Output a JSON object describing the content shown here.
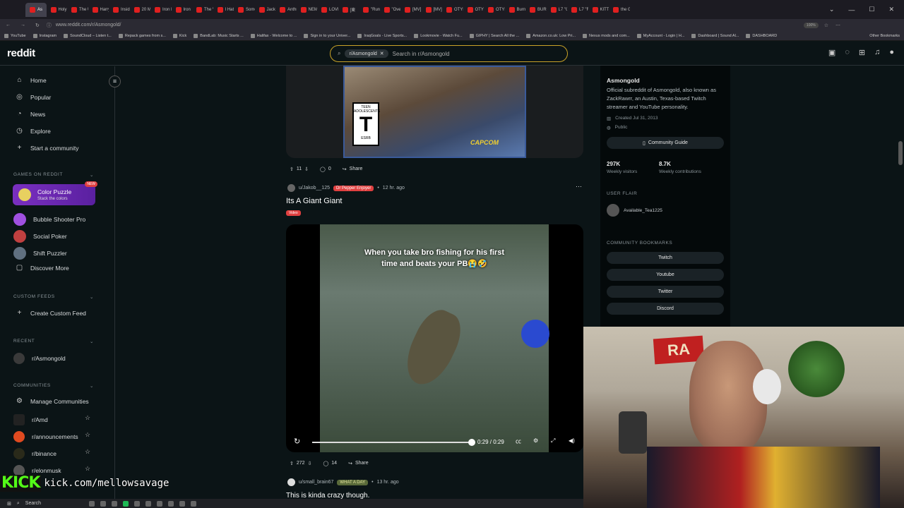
{
  "browser": {
    "tabs": [
      "As",
      "Holy",
      "The U",
      "Harry",
      "Insid",
      "20 Mi",
      "Iron M",
      "Iron M",
      "The V",
      "I Hatz",
      "Some",
      "Jack I",
      "Anthr",
      "NEMO",
      "LOVE",
      "[東",
      "\"Run",
      "\"Ove",
      "[MV]",
      "[MV]",
      "OTYK",
      "OTYK",
      "OTYK",
      "Burni",
      "BURN",
      "L7 \"C",
      "L7 \"R",
      "KITTE",
      "the G"
    ],
    "url": "www.reddit.com/r/Asmongold/",
    "zoom": "100%",
    "bookmarks": [
      "YouTube",
      "Instagram",
      "SoundCloud – Listen t...",
      "Repack games from s...",
      "Kick",
      "BandLab: Music Starts ...",
      "Halifax - Welcome to ...",
      "Sign in to your Univer...",
      "IraqGoals - Live Sports...",
      "Lookmovie - Watch Fu...",
      "GIPHY | Search All the ...",
      "Amazon.co.uk: Low Pri...",
      "Nexus mods and com...",
      "MyAccount - Login | H...",
      "Dashboard | Sound Al...",
      "DASHBOARD"
    ],
    "other_bookmarks": "Other Bookmarks"
  },
  "header": {
    "logo": "reddit",
    "search_chip": "r/Asmongold",
    "search_placeholder": "Search in r/Asmongold"
  },
  "sidebar": {
    "nav": [
      "Home",
      "Popular",
      "News",
      "Explore",
      "Start a community"
    ],
    "games_title": "GAMES ON REDDIT",
    "featured_game": {
      "name": "Color Puzzle",
      "sub": "Stack the colors",
      "badge": "NEW"
    },
    "games": [
      "Bubble Shooter Pro",
      "Social Poker",
      "Shift Puzzler",
      "Discover More"
    ],
    "custom_feeds_title": "CUSTOM FEEDS",
    "create_feed": "Create Custom Feed",
    "recent_title": "RECENT",
    "recent": [
      "r/Asmongold"
    ],
    "communities_title": "COMMUNITIES",
    "manage": "Manage Communities",
    "communities": [
      "r/Amd",
      "r/announcements",
      "r/binance",
      "r/elonmusk"
    ]
  },
  "feed": {
    "post1": {
      "upvotes": "11",
      "comments": "0",
      "share": "Share",
      "rating_top": "TEEN ADOLESCENTS",
      "rating_letter": "T",
      "rating_bottom": "ESRB",
      "publisher": "CAPCOM"
    },
    "post2": {
      "author": "u/Jakob__125",
      "flair": "Dr Pepper Enjoyer",
      "time": "12 hr. ago",
      "title": "Its A Giant Giant",
      "tag": "Video",
      "caption": "When you take bro fishing for his first time and beats your PB😭🤣",
      "time_display": "0:29 / 0:29",
      "progress": 1.0,
      "upvotes": "272",
      "comments": "14",
      "share": "Share"
    },
    "post3": {
      "author": "u/small_brain67",
      "flair": "WHAT A DAY",
      "time": "13 hr. ago",
      "title": "This is kinda crazy though."
    }
  },
  "community": {
    "name": "Asmongold",
    "description": "Official subreddit of Asmongold, also known as ZackRawrr, an Austin, Texas-based Twitch streamer and YouTube personality.",
    "created": "Created Jul 31, 2013",
    "visibility": "Public",
    "guide_button": "Community Guide",
    "visitors": "297K",
    "visitors_label": "Weekly visitors",
    "contributions": "8.7K",
    "contributions_label": "Weekly contributions",
    "user_flair_title": "USER FLAIR",
    "user_flair": "Available_Tea1225",
    "bookmarks_title": "COMMUNITY BOOKMARKS",
    "bookmarks": [
      "Twitch",
      "Youtube",
      "Twitter",
      "Discord"
    ]
  },
  "overlay": {
    "kick_logo": "KICK",
    "kick_url": "kick.com/mellowsavage",
    "webcam_sign": "RA"
  },
  "taskbar": {
    "search": "Search"
  },
  "colors": {
    "accent": "#c9a227",
    "flair": "#e04040",
    "kick_green": "#53fc18",
    "bg": "#0b1416"
  }
}
